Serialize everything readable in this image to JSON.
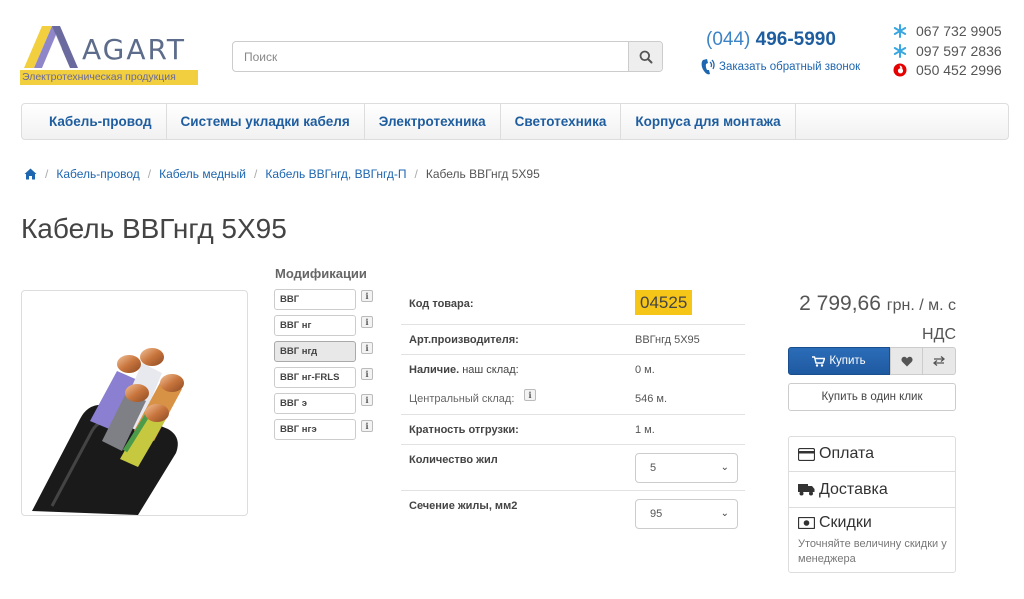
{
  "header": {
    "brand": "AGART",
    "tagline": "Электротехническая продукция",
    "search_placeholder": "Поиск",
    "phone_prefix": "(044)",
    "phone_number": "496-5990",
    "callback_label": "Заказать обратный звонок",
    "mobiles": [
      "067 732 9905",
      "097 597 2836",
      "050 452 2996"
    ]
  },
  "nav": {
    "items": [
      "Кабель-провод",
      "Системы укладки кабеля",
      "Электротехника",
      "Светотехника",
      "Корпуса для монтажа"
    ]
  },
  "breadcrumb": {
    "items": [
      "Кабель-провод",
      "Кабель медный",
      "Кабель ВВГнгд, ВВГнгд-П"
    ],
    "current": "Кабель ВВГнгд 5X95"
  },
  "product": {
    "title": "Кабель ВВГнгд 5X95",
    "modifications_title": "Модификации",
    "modifications": [
      "ВВГ",
      "ВВГ нг",
      "ВВГ нгд",
      "ВВГ нг-FRLS",
      "ВВГ э",
      "ВВГ нгэ"
    ],
    "active_modification": "ВВГ нгд",
    "specs": {
      "code_label": "Код товара:",
      "code_value": "04525",
      "article_label": "Арт.производителя:",
      "article_value": "ВВГнгд 5Х95",
      "availability_label": "Наличие.",
      "availability_sub": "наш склад:",
      "availability_value": "0 м.",
      "central_label": "Центральный склад:",
      "central_value": "546 м.",
      "multiplicity_label": "Кратность отгрузки:",
      "multiplicity_value": "1 м.",
      "cores_label": "Количество жил",
      "cores_value": "5",
      "section_label": "Сечение жилы, мм2",
      "section_value": "95"
    },
    "price_value": "2 799,66",
    "price_unit": "грн. / м. с",
    "price_vat": "НДС",
    "buy_label": "Купить",
    "one_click_label": "Купить в один клик"
  },
  "info_panel": {
    "payment": "Оплата",
    "delivery": "Доставка",
    "discounts": "Скидки",
    "discount_note": "Уточняйте величину скидки у менеджера"
  },
  "colors": {
    "link": "#1e66b0",
    "buy_button": "#2163ac",
    "highlight": "#f5c518",
    "logo_yellow": "#f2cf3f"
  }
}
